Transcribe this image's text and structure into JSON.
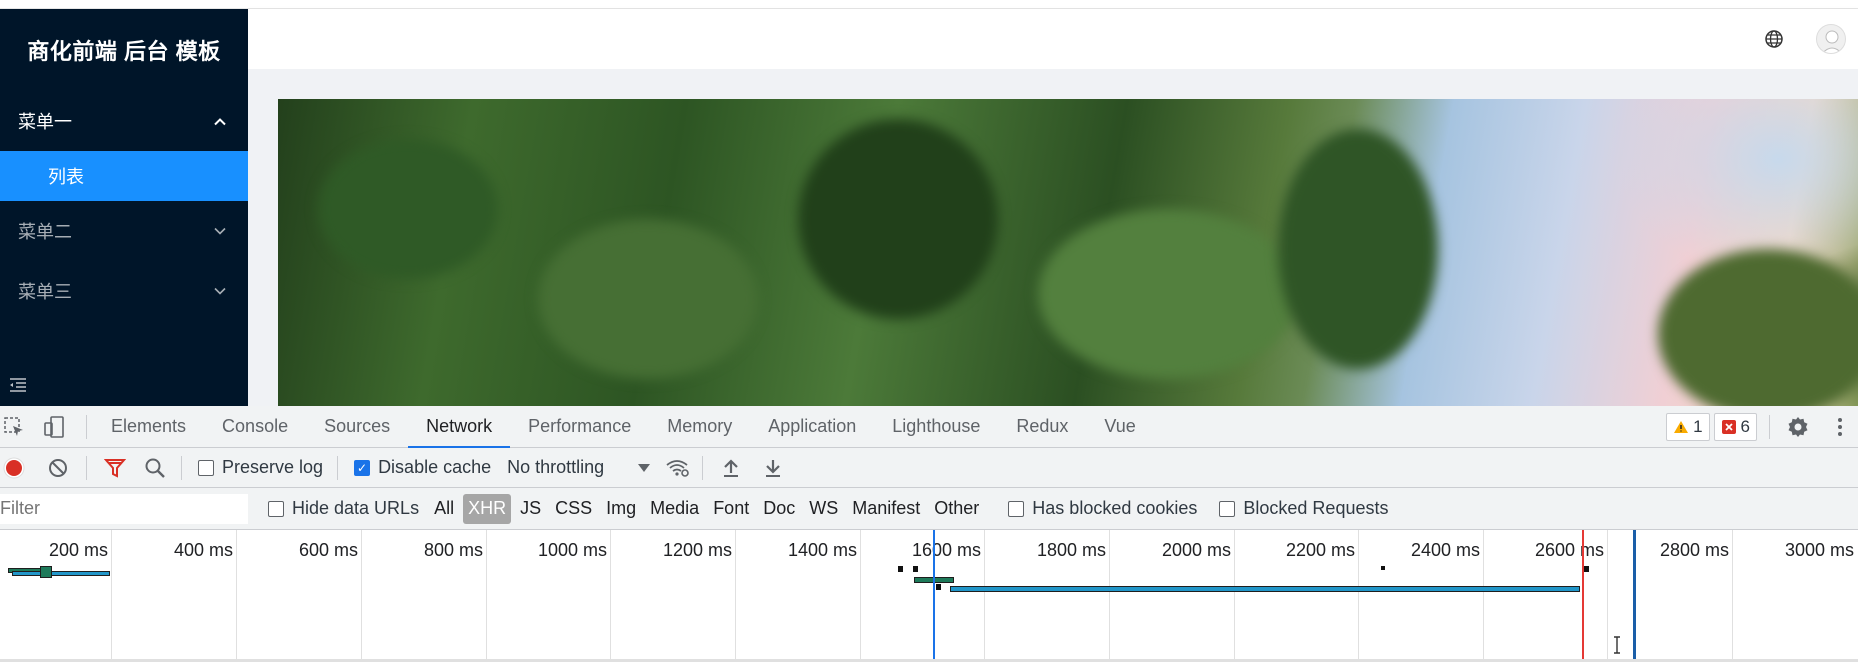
{
  "app": {
    "logo": "商化前端 后台 模板",
    "menu": [
      {
        "label": "菜单一",
        "arrow": "⌃",
        "open": true
      },
      {
        "label": "菜单二",
        "arrow": "⌄",
        "open": false
      },
      {
        "label": "菜单三",
        "arrow": "⌄",
        "open": false
      }
    ],
    "submenu_active": "列表",
    "colors": {
      "sidebar": "#001529",
      "active": "#1890ff"
    }
  },
  "devtools": {
    "tabs": [
      "Elements",
      "Console",
      "Sources",
      "Network",
      "Performance",
      "Memory",
      "Application",
      "Lighthouse",
      "Redux",
      "Vue"
    ],
    "active_tab": "Network",
    "warnings": "1",
    "errors": "6",
    "toolbar": {
      "preserve_log": "Preserve log",
      "disable_cache": "Disable cache",
      "throttling": "No throttling"
    },
    "filter": {
      "placeholder": "Filter",
      "hide_data_urls": "Hide data URLs",
      "types": [
        "All",
        "XHR",
        "JS",
        "CSS",
        "Img",
        "Media",
        "Font",
        "Doc",
        "WS",
        "Manifest",
        "Other"
      ],
      "active_type": "XHR",
      "has_blocked_cookies": "Has blocked cookies",
      "blocked_requests": "Blocked Requests"
    },
    "timeline_ticks": [
      "200 ms",
      "400 ms",
      "600 ms",
      "800 ms",
      "1000 ms",
      "1200 ms",
      "1400 ms",
      "1600 ms",
      "1800 ms",
      "2000 ms",
      "2200 ms",
      "2400 ms",
      "2600 ms",
      "2800 ms",
      "3000 ms"
    ],
    "colors": {
      "dom_content_loaded": "#1a73e8",
      "load": "#e53935",
      "active_tab_underline": "#1a73e8"
    }
  }
}
